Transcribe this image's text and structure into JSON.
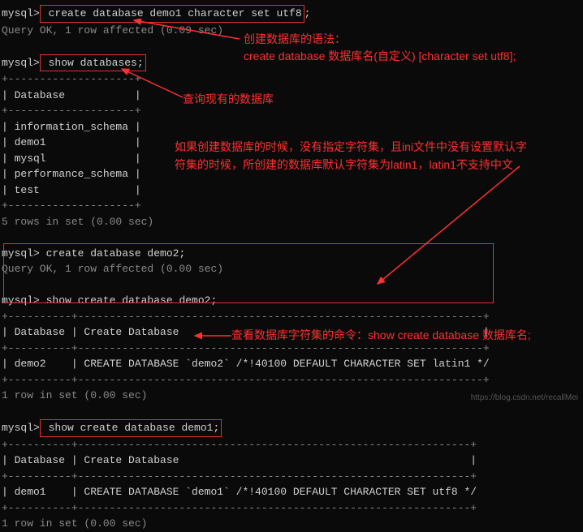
{
  "terminal": {
    "prompt": "mysql>",
    "cmd1": " create database demo1 character set utf8",
    "semicolon": ";",
    "result1": "Query OK, 1 row affected (0.09 sec)",
    "cmd2": " show databases;",
    "table1_border_top": "+--------------------+",
    "table1_header": "| Database           |",
    "table1_row1": "| information_schema |",
    "table1_row2": "| demo1              |",
    "table1_row3": "| mysql              |",
    "table1_row4": "| performance_schema |",
    "table1_row5": "| test               |",
    "result2": "5 rows in set (0.00 sec)",
    "cmd3": " create database demo2;",
    "result3": "Query OK, 1 row affected (0.00 sec)",
    "cmd4": " show create database demo2;",
    "table2_border_top": "+----------+----------------------------------------------------------------+",
    "table2_header": "| Database | Create Database                                                |",
    "table2_row": "| demo2    | CREATE DATABASE `demo2` /*!40100 DEFAULT CHARACTER SET latin1 */",
    "result4": "1 row in set (0.00 sec)",
    "cmd5": " show create database demo1;",
    "table3_border_top": "+----------+--------------------------------------------------------------+",
    "table3_header": "| Database | Create Database                                              |",
    "table3_row": "| demo1    | CREATE DATABASE `demo1` /*!40100 DEFAULT CHARACTER SET utf8 */",
    "result5": "1 row in set (0.00 sec)"
  },
  "annotations": {
    "a1_line1": "创建数据库的语法：",
    "a1_line2": "create database 数据库名(自定义) [character set utf8];",
    "a2": "查询现有的数据库",
    "a3_line1": "如果创建数据库的时候，没有指定字符集，且ini文件中没有设置默认字",
    "a3_line2": "符集的时候，所创建的数据库默认字符集为latin1，latin1不支持中文",
    "a4": "查看数据库字符集的命令：show create database 数据库名;"
  },
  "watermark": "https://blog.csdn.net/recallMei"
}
